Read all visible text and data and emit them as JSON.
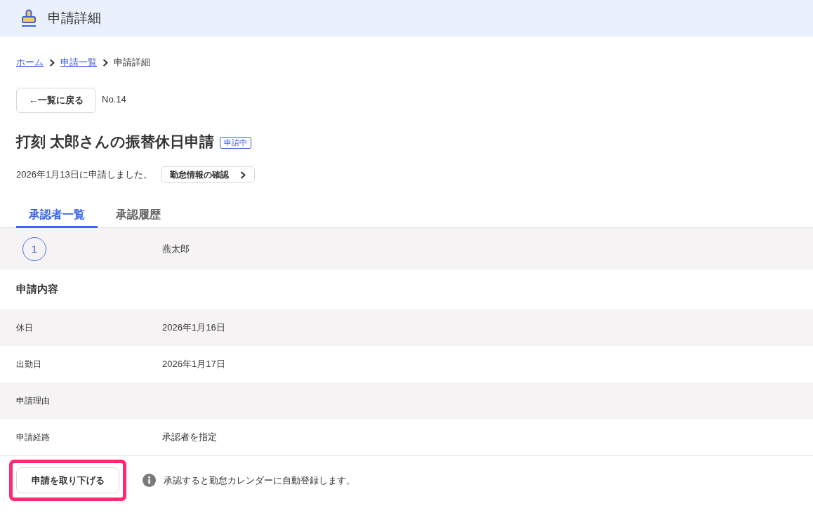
{
  "header": {
    "title": "申請詳細"
  },
  "breadcrumb": [
    {
      "label": "ホーム",
      "kind": "link"
    },
    {
      "label": "申請一覧",
      "kind": "link"
    },
    {
      "label": "申請詳細",
      "kind": "current"
    }
  ],
  "back_button": {
    "label": "←一覧に戻る"
  },
  "request_number": "No.14",
  "title": "打刻 太郎さんの振替休日申請",
  "status_badge": "申請中",
  "applied_text": "2026年1月13日に申請しました。",
  "attendance_button": {
    "label": "勤怠情報の確認"
  },
  "tabs": [
    {
      "label": "承認者一覧",
      "selected": true
    },
    {
      "label": "承認履歴",
      "selected": false
    }
  ],
  "approvers": [
    {
      "step": "1",
      "name": "燕太郎"
    }
  ],
  "details": {
    "heading": "申請内容",
    "rows": [
      {
        "label": "休日",
        "value": "2026年1月16日"
      },
      {
        "label": "出勤日",
        "value": "2026年1月17日"
      },
      {
        "label": "申請理由"
      },
      {
        "label": "申請経路",
        "value": "承認者を指定"
      }
    ]
  },
  "withdraw_button": {
    "label": "申請を取り下げる",
    "highlighted": true
  },
  "notice": "承認すると勤怠カレンダーに自動登録します。"
}
